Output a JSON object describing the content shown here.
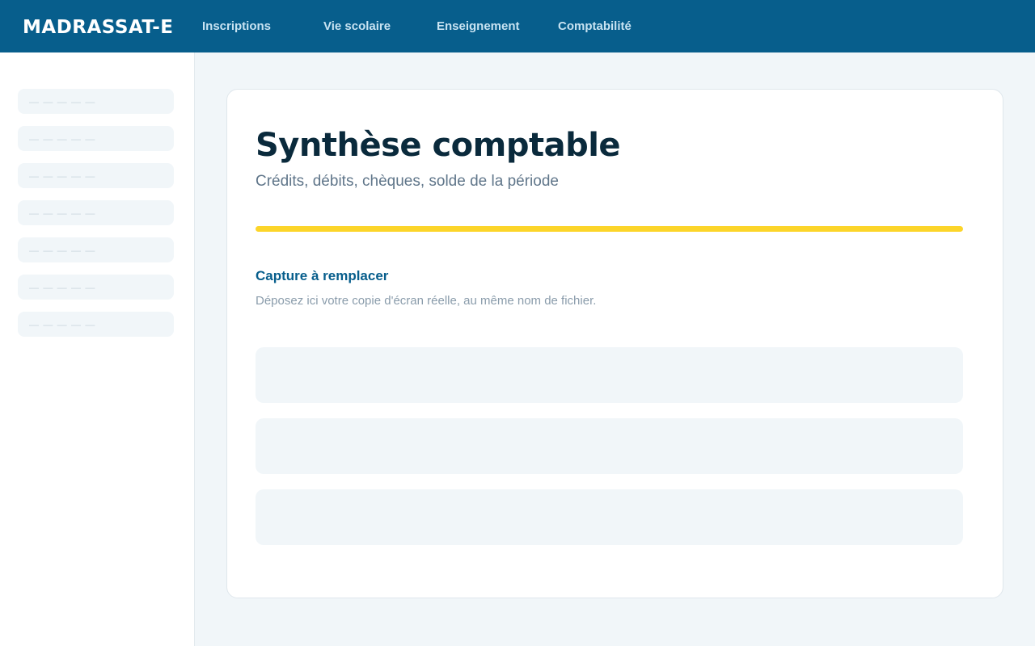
{
  "header": {
    "logo": "MADRASSAT-E",
    "nav": [
      {
        "label": "Inscriptions"
      },
      {
        "label": "Vie scolaire"
      },
      {
        "label": "Enseignement"
      },
      {
        "label": "Comptabilité"
      }
    ]
  },
  "sidebar": {
    "items": [
      {
        "label": "— — — — —"
      },
      {
        "label": "— — — — —"
      },
      {
        "label": "— — — — —"
      },
      {
        "label": "— — — — —"
      },
      {
        "label": "— — — — —"
      },
      {
        "label": "— — — — —"
      },
      {
        "label": "— — — — —"
      }
    ]
  },
  "main": {
    "title": "Synthèse comptable",
    "subtitle": "Crédits, débits, chèques, solde de la période",
    "capture_heading": "Capture à remplacer",
    "capture_hint": "Déposez ici votre copie d'écran réelle, au même nom de fichier."
  },
  "colors": {
    "header_bg": "#075e8c",
    "accent": "#fcd52a",
    "title": "#0a2a3c",
    "link": "#075e8c",
    "page_bg": "#f1f6f9"
  }
}
